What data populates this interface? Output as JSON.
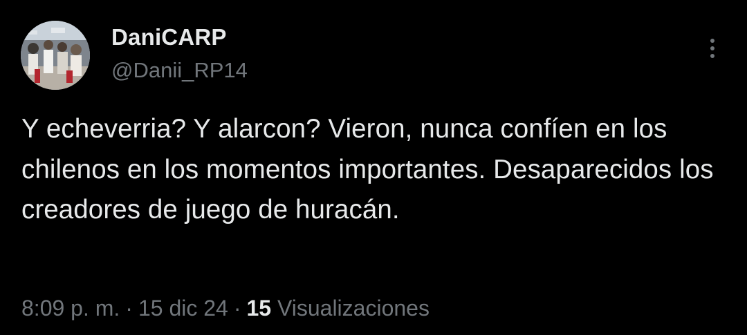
{
  "tweet": {
    "author": {
      "display_name": "DaniCARP",
      "handle": "@Danii_RP14",
      "avatar_icon": "crowd-photo-avatar"
    },
    "text": "Y echeverria? Y alarcon? Vieron, nunca confíen en los chilenos en los momentos importantes. Desaparecidos los creadores de juego de huracán.",
    "time": "8:09 p. m.",
    "separator": "·",
    "date": "15 dic 24",
    "views_count": "15",
    "views_label": "Visualizaciones",
    "more_icon": "more-vertical-icon"
  },
  "colors": {
    "background": "#000000",
    "primary_text": "#e7e9ea",
    "secondary_text": "#71767b"
  }
}
